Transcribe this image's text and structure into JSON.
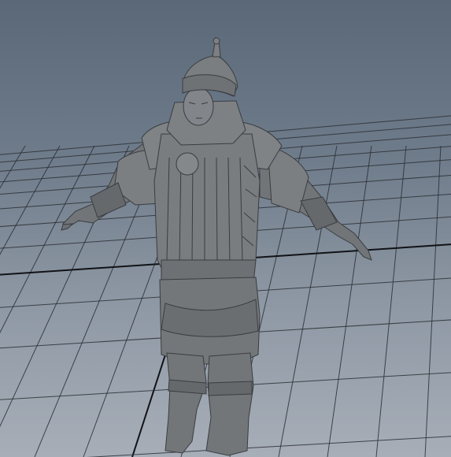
{
  "viewport": {
    "type": "3d-perspective-viewport",
    "background_colors": [
      "#5a6878",
      "#8d97a3",
      "#a7aeb8"
    ],
    "grid_color": "#2b2f35",
    "model_color": "#777a7d",
    "grid_visible": true
  },
  "model": {
    "name": "mongol-warrior-mesh",
    "pose": "T-pose",
    "parts": [
      "helmet",
      "head",
      "armor-vest",
      "left-arm",
      "right-arm",
      "skirt",
      "left-boot",
      "right-boot"
    ]
  }
}
